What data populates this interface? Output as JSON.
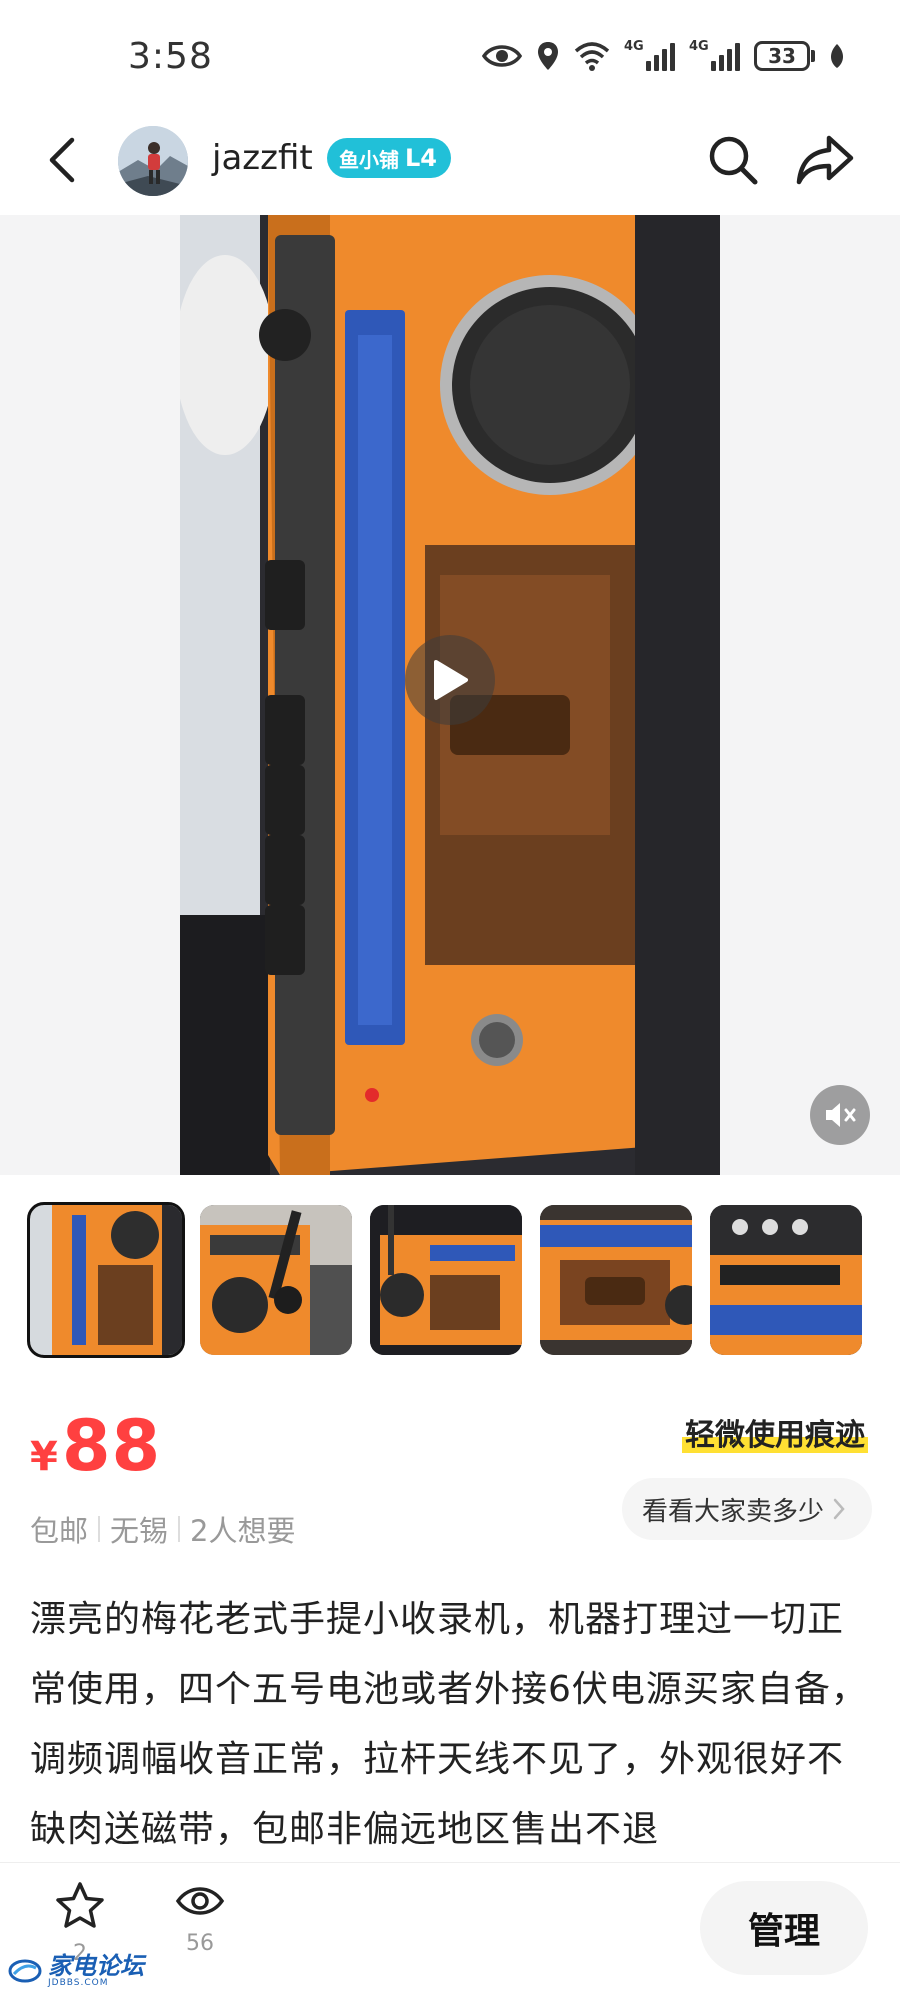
{
  "status_bar": {
    "time": "3:58",
    "network_1": "4G",
    "network_2": "4G",
    "battery": "33",
    "icons": [
      "eye-icon",
      "location-icon",
      "wifi-icon",
      "signal-icon",
      "signal-icon",
      "battery-icon",
      "leaf-icon"
    ]
  },
  "header": {
    "username": "jazzfit",
    "badge_text": "鱼小铺",
    "badge_level": "L4",
    "badge_color": "#21c0d8"
  },
  "media": {
    "thumbnail_count": 5,
    "selected_thumbnail": 1
  },
  "listing": {
    "currency": "¥",
    "price": "88",
    "condition": "轻微使用痕迹",
    "meta": [
      "包邮",
      "无锡",
      "2人想要"
    ],
    "see_prices_label": "看看大家卖多少",
    "description": "漂亮的梅花老式手提小收录机，机器打理过一切正常使用，四个五号电池或者外接6伏电源买家自备，调频调幅收音正常，拉杆天线不见了，外观很好不缺肉送磁带，包邮非偏远地区售出不退"
  },
  "bottom_bar": {
    "favorites_count": "2",
    "views_count": "56",
    "manage_label": "管理"
  },
  "watermark": {
    "text": "家电论坛",
    "sub": "JDBBS.COM"
  },
  "colors": {
    "price": "#ff4040",
    "highlight": "#ffe033",
    "radio_orange": "#f08a2c",
    "dial_blue": "#2f58b8"
  }
}
